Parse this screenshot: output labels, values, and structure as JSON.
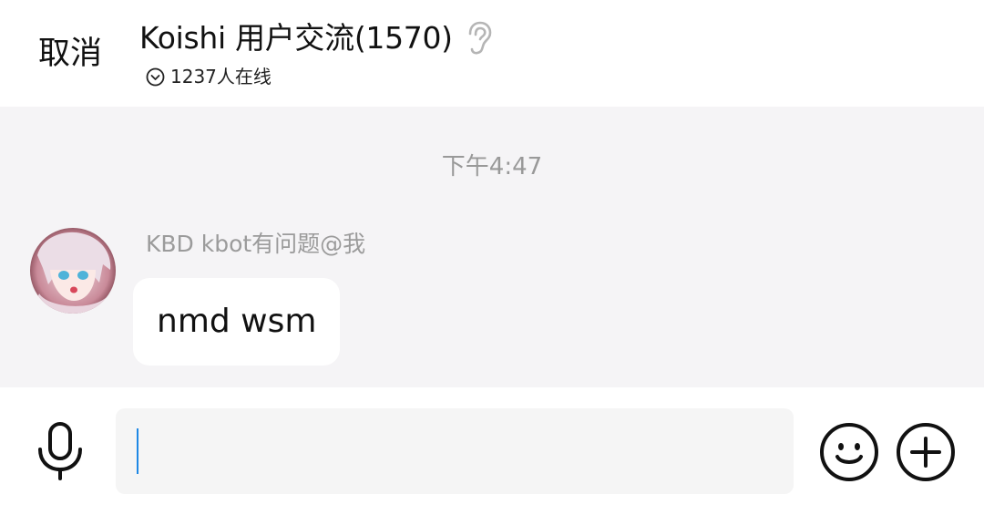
{
  "header": {
    "cancel_label": "取消",
    "title": "Koishi 用户交流(1570)",
    "online_text": "1237人在线"
  },
  "chat": {
    "timestamp": "下午4:47",
    "messages": [
      {
        "sender": "KBD kbot有问题@我",
        "text": "nmd wsm"
      }
    ]
  },
  "input_bar": {
    "input_value": ""
  },
  "icons": {
    "ear": "ear-icon",
    "chevron": "chevron-down-circle-icon",
    "mic": "microphone-icon",
    "emoji": "emoji-icon",
    "plus": "plus-circle-icon"
  },
  "colors": {
    "chat_background": "#f5f4f6",
    "caret": "#1e88e5",
    "secondary_text": "#999999"
  }
}
